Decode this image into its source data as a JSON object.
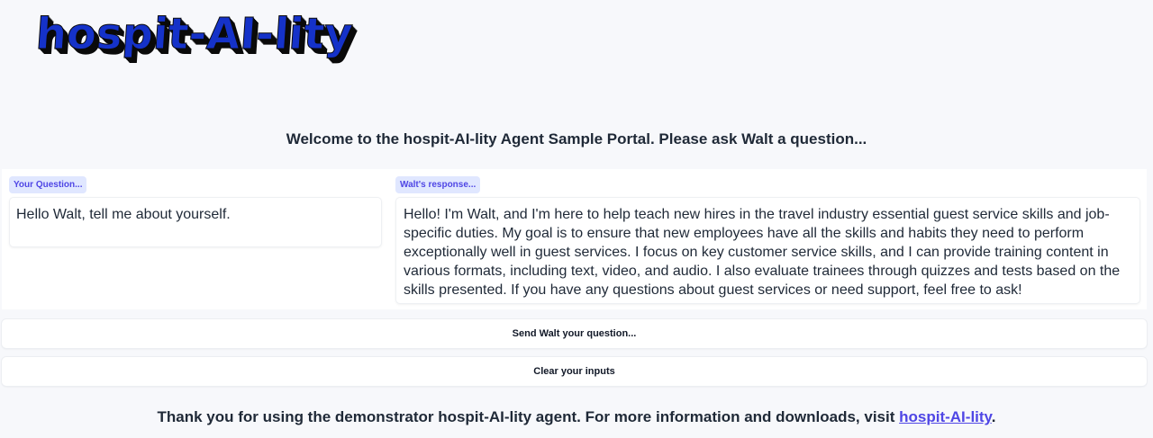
{
  "logo": {
    "text": "hospit-AI-lity"
  },
  "welcome_text": "Welcome to the hospit-AI-lity Agent Sample Portal. Please ask Walt a question...",
  "question": {
    "label": "Your Question...",
    "value": "Hello Walt, tell me about yourself."
  },
  "response": {
    "label": "Walt's response...",
    "value": "Hello! I'm Walt, and I'm here to help teach new hires in the travel industry essential guest service skills and job-specific duties. My goal is to ensure that new employees have all the skills and habits they need to perform exceptionally well in guest services. I focus on key customer service skills, and I can provide training content in various formats, including text, video, and audio. I also evaluate trainees through quizzes and tests based on the skills presented. If you have any questions about guest services or need support, feel free to ask!"
  },
  "buttons": {
    "send": "Send Walt your question...",
    "clear": "Clear your inputs"
  },
  "footer": {
    "text": "Thank you for using the demonstrator hospit-AI-lity agent. For more information and downloads, visit ",
    "link_text": "hospit-AI-lity",
    "trailing": "."
  },
  "colors": {
    "background": "#f7f8fb",
    "logo_blue": "#1532c9",
    "tag_bg": "#e0e7ff",
    "accent": "#4f46e5"
  }
}
